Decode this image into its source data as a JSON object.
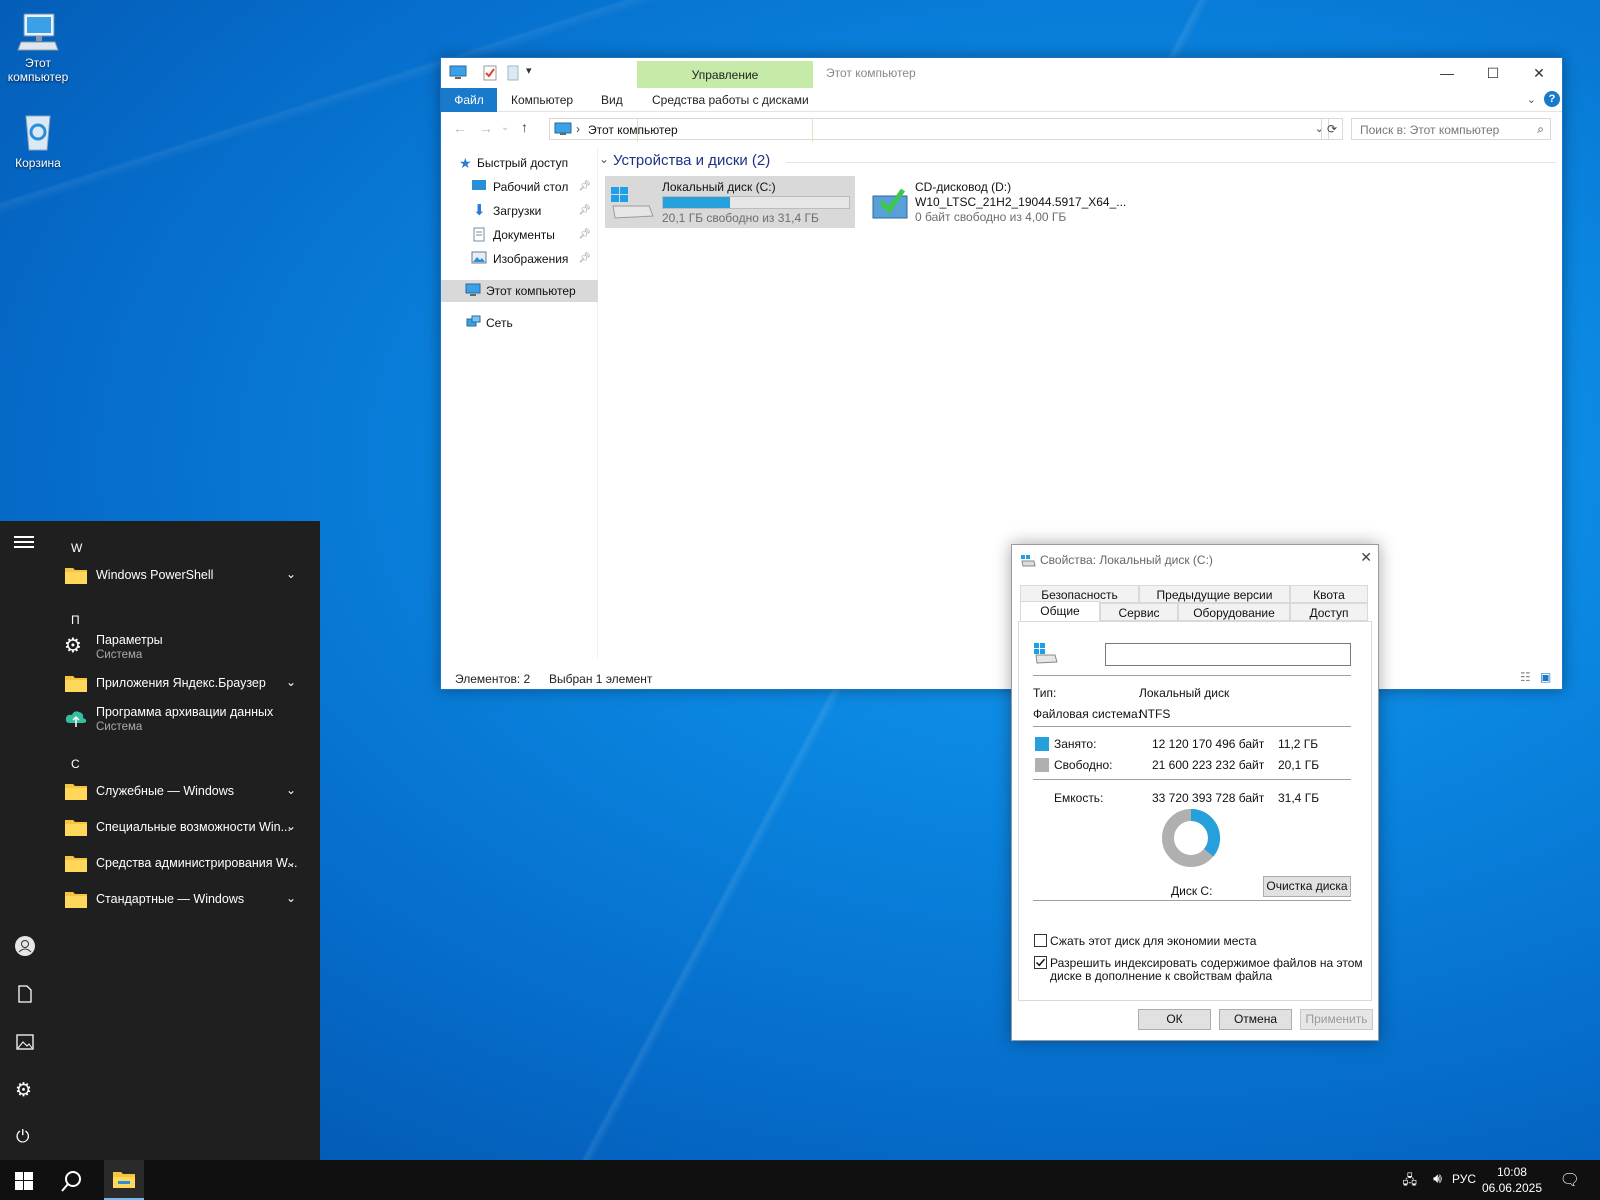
{
  "desktop": {
    "icons": [
      {
        "label": "Этот компьютер"
      },
      {
        "label": "Корзина"
      }
    ]
  },
  "explorer": {
    "title": "Этот компьютер",
    "context_tab_header": "Управление",
    "tabs": {
      "file": "Файл",
      "computer": "Компьютер",
      "view": "Вид",
      "disk_tools": "Средства работы с дисками"
    },
    "address": "Этот компьютер",
    "search_placeholder": "Поиск в: Этот компьютер",
    "nav": {
      "quick_access": "Быстрый доступ",
      "desktop": "Рабочий стол",
      "downloads": "Загрузки",
      "documents": "Документы",
      "pictures": "Изображения",
      "this_pc": "Этот компьютер",
      "network": "Сеть"
    },
    "group_header": "Устройства и диски (2)",
    "drives": [
      {
        "name": "Локальный диск (C:)",
        "free_text": "20,1 ГБ свободно из 31,4 ГБ",
        "used_fraction": 0.36
      },
      {
        "name": "CD-дисковод (D:)",
        "volume": "W10_LTSC_21H2_19044.5917_X64_...",
        "free_text": "0 байт свободно из 4,00 ГБ"
      }
    ],
    "status": {
      "items": "Элементов: 2",
      "selected": "Выбран 1 элемент"
    }
  },
  "props": {
    "title": "Свойства: Локальный диск (C:)",
    "tabs_row1": [
      "Безопасность",
      "Предыдущие версии",
      "Квота"
    ],
    "tabs_row2": [
      "Общие",
      "Сервис",
      "Оборудование",
      "Доступ"
    ],
    "name_value": "",
    "type_label": "Тип:",
    "type_value": "Локальный диск",
    "fs_label": "Файловая система:",
    "fs_value": "NTFS",
    "used_label": "Занято:",
    "used_bytes": "12 120 170 496 байт",
    "used_gb": "11,2 ГБ",
    "free_label": "Свободно:",
    "free_bytes": "21 600 223 232 байт",
    "free_gb": "20,1 ГБ",
    "cap_label": "Емкость:",
    "cap_bytes": "33 720 393 728 байт",
    "cap_gb": "31,4 ГБ",
    "disk_label": "Диск C:",
    "cleanup_button": "Очистка диска",
    "compress_label": "Сжать этот диск для экономии места",
    "compress_checked": false,
    "index_label_1": "Разрешить индексировать содержимое файлов на этом",
    "index_label_2": "диске в дополнение к свойствам файла",
    "index_checked": true,
    "ok": "ОК",
    "cancel": "Отмена",
    "apply": "Применить",
    "used_fraction": 0.36,
    "colors": {
      "used": "#26a0da",
      "free": "#b0b0b0"
    }
  },
  "start_menu": {
    "letters": [
      "W",
      "П",
      "С"
    ],
    "items": [
      {
        "name": "Windows PowerShell",
        "kind": "folder"
      },
      {
        "name": "Параметры",
        "sub": "Система",
        "kind": "gear"
      },
      {
        "name": "Приложения Яндекс.Браузер",
        "kind": "folder"
      },
      {
        "name": "Программа архивации данных",
        "sub": "Система",
        "kind": "backup"
      },
      {
        "name": "Служебные — Windows",
        "kind": "folder"
      },
      {
        "name": "Специальные возможности Win...",
        "kind": "folder"
      },
      {
        "name": "Средства администрирования W...",
        "kind": "folder"
      },
      {
        "name": "Стандартные — Windows",
        "kind": "folder"
      }
    ]
  },
  "taskbar": {
    "lang": "РУС",
    "time": "10:08",
    "date": "06.06.2025"
  }
}
